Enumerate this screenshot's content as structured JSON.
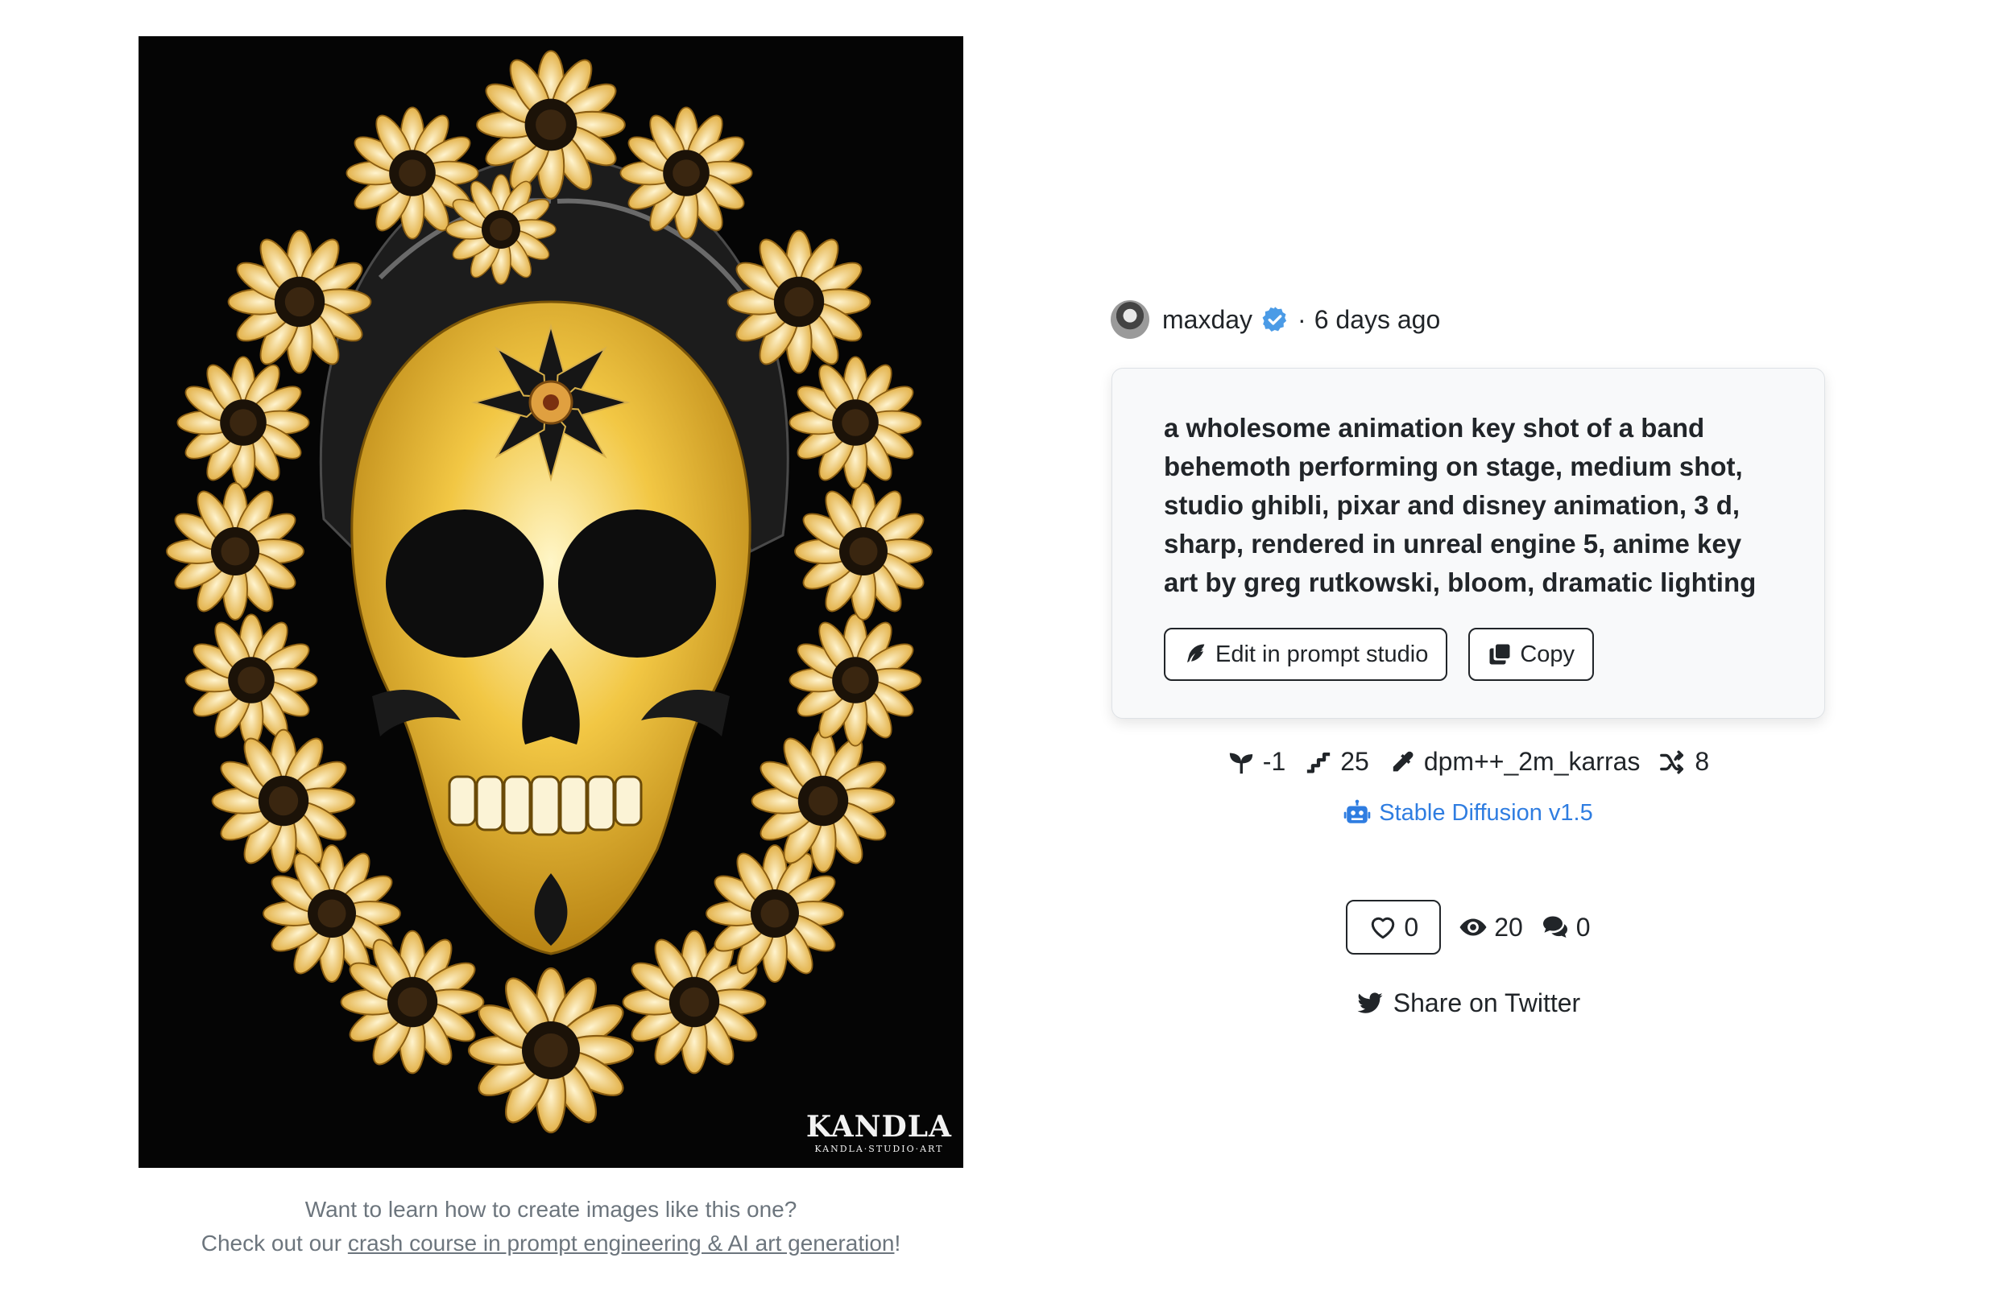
{
  "author": {
    "name": "maxday",
    "separator": "·",
    "posted": "6 days ago"
  },
  "prompt": {
    "text": "a wholesome animation key shot of a band behemoth performing on stage, medium shot, studio ghibli, pixar and disney animation, 3 d, sharp, rendered in unreal engine 5, anime key art by greg rutkowski, bloom, dramatic lighting",
    "edit_label": "Edit in prompt studio",
    "copy_label": "Copy"
  },
  "params": {
    "seed": "-1",
    "steps": "25",
    "sampler": "dpm++_2m_karras",
    "cfg": "8"
  },
  "model": {
    "label": "Stable Diffusion v1.5"
  },
  "stats": {
    "likes": "0",
    "views": "20",
    "comments": "0"
  },
  "share": {
    "label": "Share on Twitter"
  },
  "artwork": {
    "watermark": "KANDLA",
    "watermark_sub": "KANDLA·STUDIO·ART"
  },
  "learn": {
    "line1": "Want to learn how to create images like this one?",
    "line2_prefix": "Check out our ",
    "link_text": "crash course in prompt engineering & AI art generation",
    "line2_suffix": "!"
  },
  "colors": {
    "accent": "#2f7de1",
    "verified": "#4b9be6",
    "skull": "#f0c33c",
    "text": "#212529"
  },
  "icons": [
    "verified-badge-icon",
    "feather-icon",
    "copy-icon",
    "seedling-icon",
    "stairs-icon",
    "eyedropper-icon",
    "shuffle-icon",
    "robot-icon",
    "heart-icon",
    "eye-icon",
    "comments-icon",
    "twitter-icon"
  ]
}
